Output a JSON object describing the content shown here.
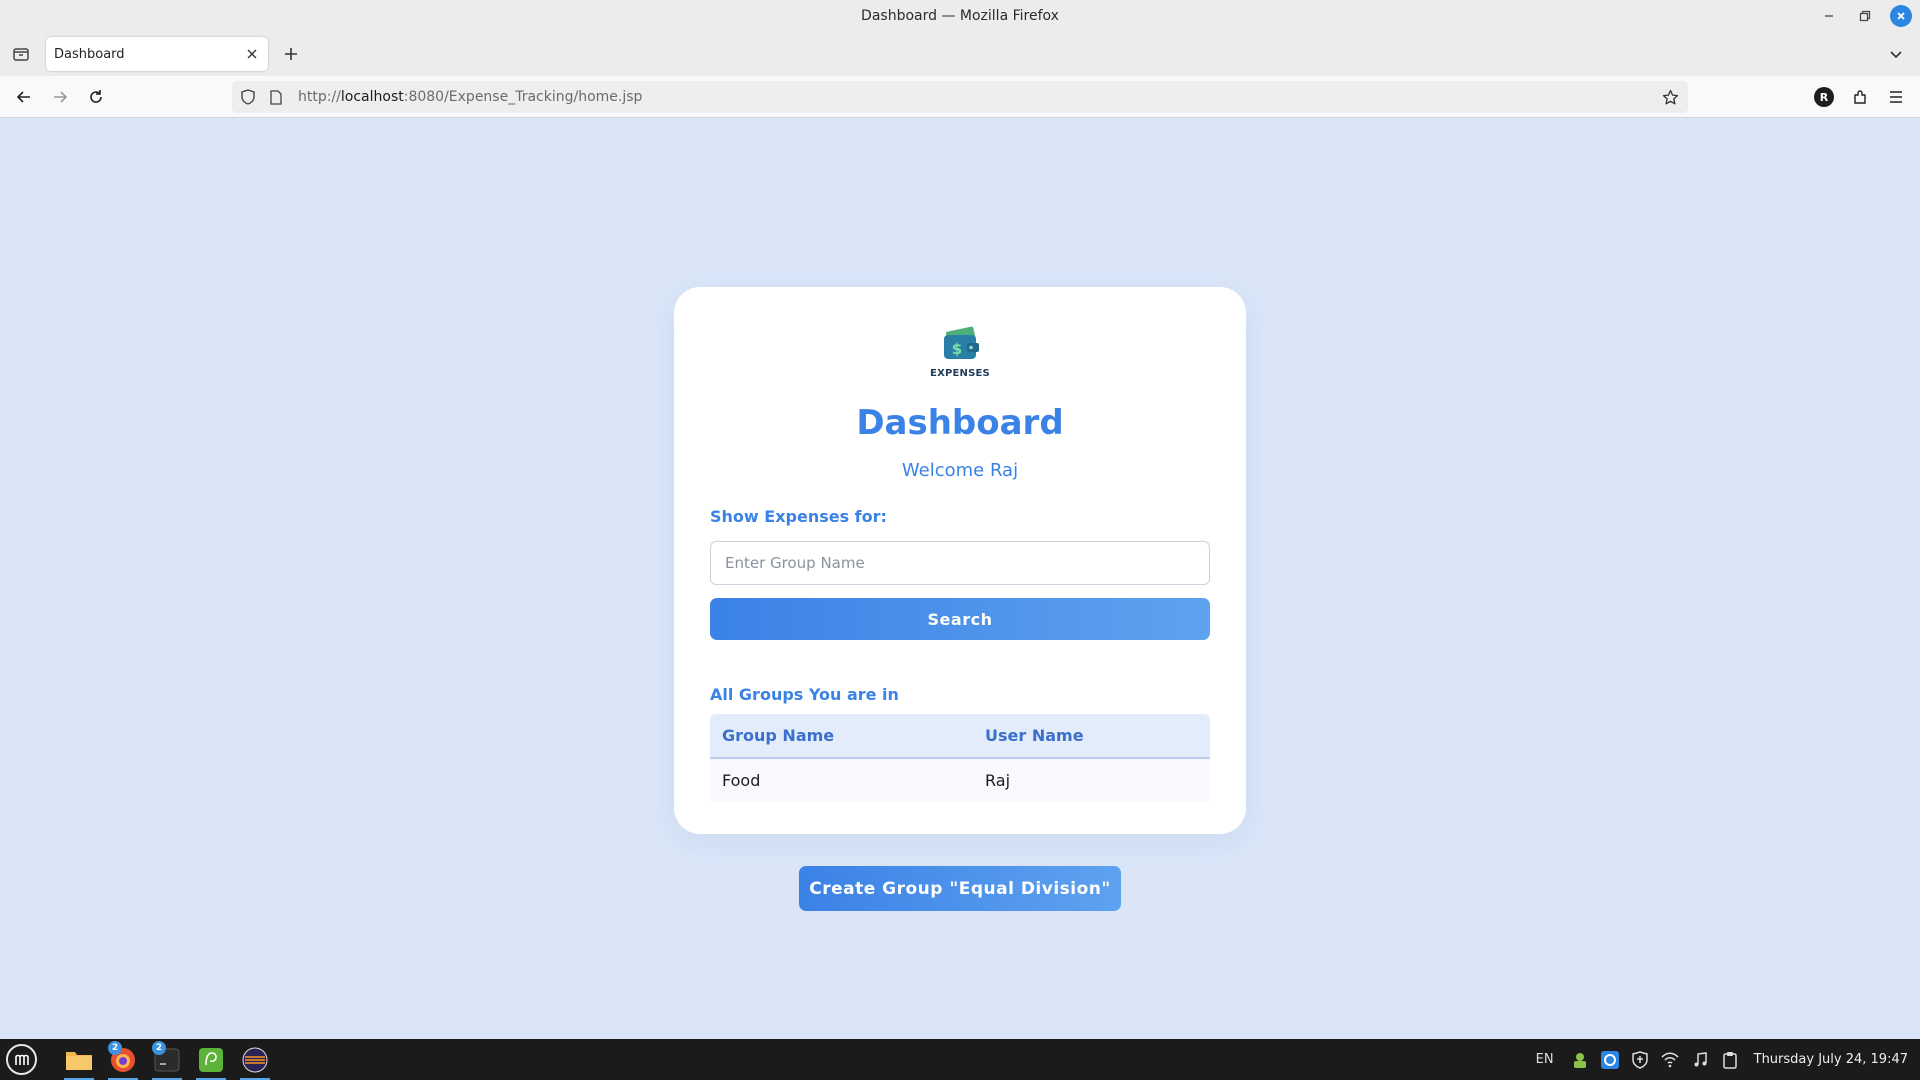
{
  "window": {
    "title": "Dashboard — Mozilla Firefox"
  },
  "tabs": [
    {
      "label": "Dashboard"
    }
  ],
  "urlbar": {
    "prefix": "http://",
    "host": "localhost",
    "path": ":8080/Expense_Tracking/home.jsp"
  },
  "account": {
    "initial": "R"
  },
  "page": {
    "logo_text": "EXPENSES",
    "title": "Dashboard",
    "welcome": "Welcome Raj",
    "show_label": "Show Expenses for:",
    "group_input": {
      "placeholder": "Enter Group Name",
      "value": ""
    },
    "search_label": "Search",
    "groups_label": "All Groups You are in",
    "table": {
      "headers": [
        "Group Name",
        "User Name"
      ],
      "rows": [
        [
          "Food",
          "Raj"
        ]
      ]
    },
    "create_button": "Create Group \"Equal Division\""
  },
  "taskbar": {
    "apps": [
      {
        "icon": "files-icon",
        "badge": ""
      },
      {
        "icon": "firefox-icon",
        "badge": "2"
      },
      {
        "icon": "terminal-icon",
        "badge": "2"
      },
      {
        "icon": "postgres-icon",
        "badge": ""
      },
      {
        "icon": "eclipse-icon",
        "badge": ""
      }
    ],
    "language": "EN",
    "clock": "Thursday July 24, 19:47"
  },
  "colors": {
    "accent": "#3b82e6",
    "page_bg": "#dae6f8",
    "card_bg": "#ffffff"
  }
}
